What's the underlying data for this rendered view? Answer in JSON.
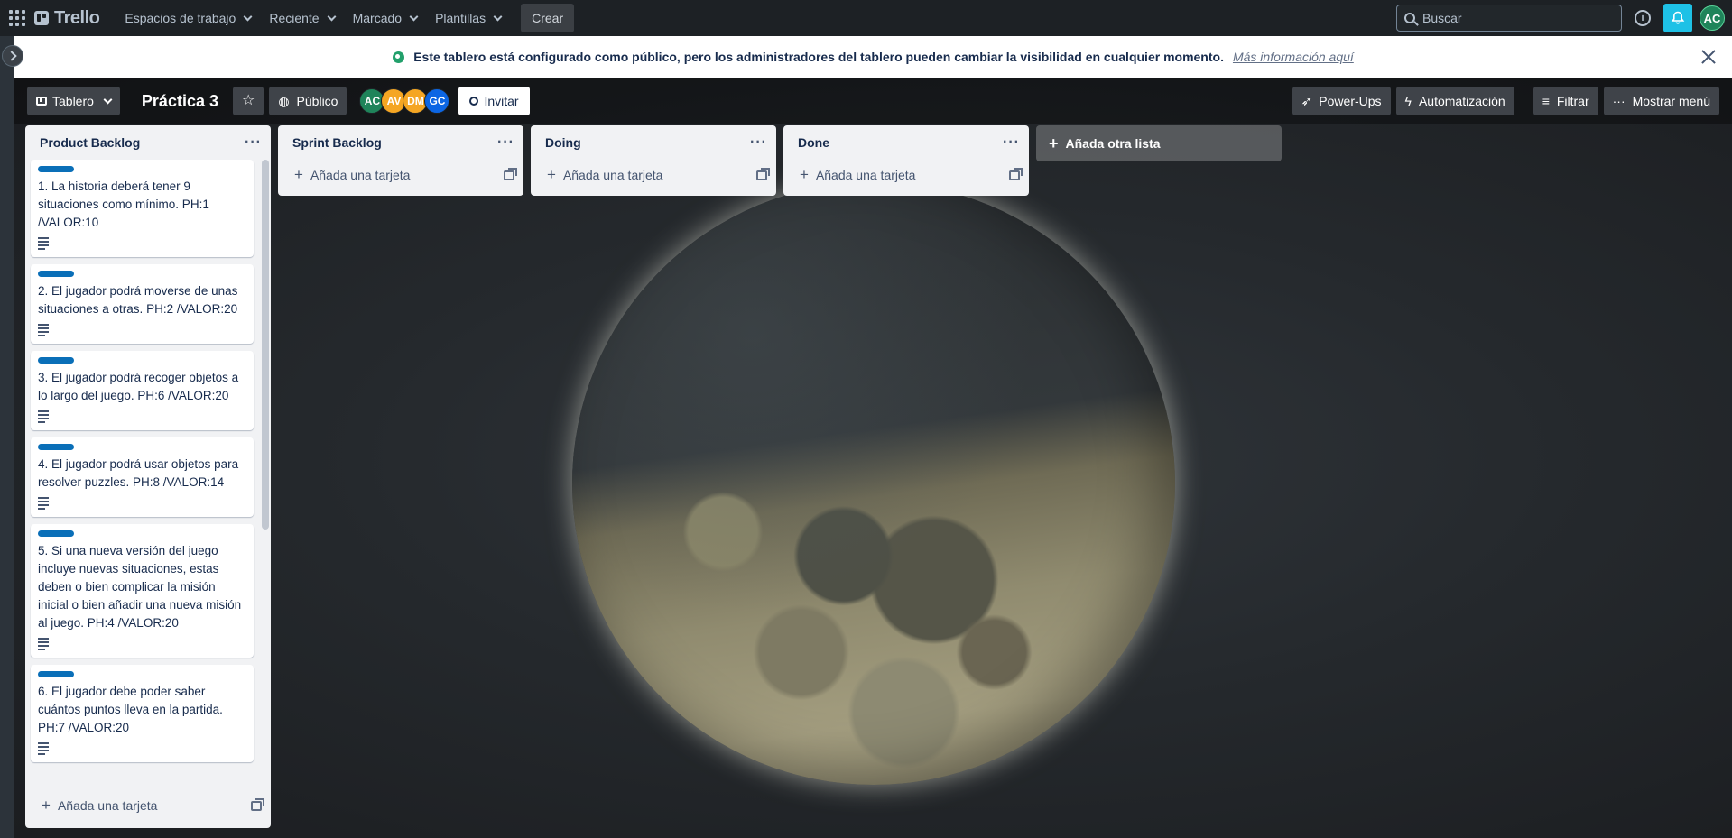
{
  "nav": {
    "logo": "Trello",
    "menus": [
      "Espacios de trabajo",
      "Reciente",
      "Marcado",
      "Plantillas"
    ],
    "create": "Crear",
    "search_placeholder": "Buscar",
    "user_initials": "AC"
  },
  "banner": {
    "message": "Este tablero está configurado como público, pero los administradores del tablero pueden cambiar la visibilidad en cualquier momento.",
    "link": "Más información aquí"
  },
  "board": {
    "view": "Tablero",
    "title": "Práctica 3",
    "visibility": "Público",
    "members": [
      {
        "initials": "AC",
        "color": "#1f845a"
      },
      {
        "initials": "AV",
        "color": "#f5a623"
      },
      {
        "initials": "DM",
        "color": "#f5a623"
      },
      {
        "initials": "GC",
        "color": "#0c66e4"
      }
    ],
    "invite": "Invitar",
    "powerups": "Power-Ups",
    "automation": "Automatización",
    "filter": "Filtrar",
    "menu": "Mostrar menú",
    "add_list": "Añada otra lista"
  },
  "lists": [
    {
      "title": "Product Backlog",
      "cards": [
        "1. La historia deberá tener 9 situaciones como mínimo. PH:1 /VALOR:10",
        "2. El jugador podrá moverse de unas situaciones a otras. PH:2 /VALOR:20",
        "3. El jugador podrá recoger objetos a lo largo del juego. PH:6 /VALOR:20",
        "4. El jugador podrá usar objetos para resolver puzzles. PH:8 /VALOR:14",
        "5. Si una nueva versión del juego incluye nuevas situaciones, estas deben o bien complicar la misión inicial o bien añadir una nueva misión al juego. PH:4 /VALOR:20",
        "6. El jugador debe poder saber cuántos puntos lleva en la partida. PH:7 /VALOR:20"
      ],
      "add_card": "Añada una tarjeta"
    },
    {
      "title": "Sprint Backlog",
      "add_card": "Añada una tarjeta"
    },
    {
      "title": "Doing",
      "add_card": "Añada una tarjeta"
    },
    {
      "title": "Done",
      "add_card": "Añada una tarjeta"
    }
  ],
  "colors": {
    "nav_bg": "#1d2125",
    "label_blue": "#0a6fb8",
    "notification": "#1ec1e6"
  }
}
